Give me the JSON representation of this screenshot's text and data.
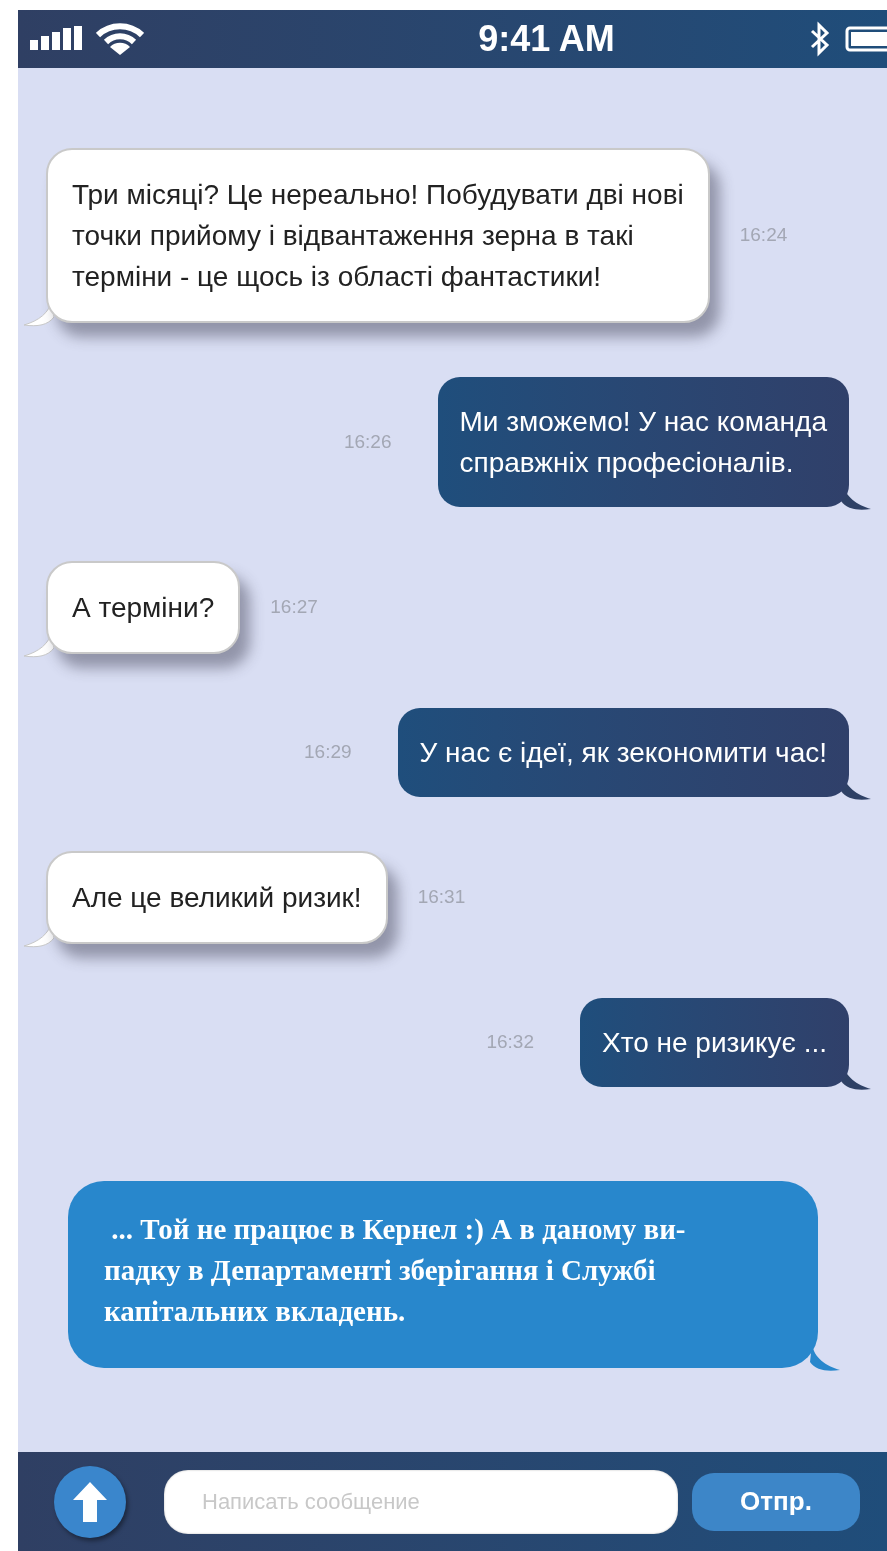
{
  "status_bar": {
    "time": "9:41 AM"
  },
  "messages": [
    {
      "kind": "incoming",
      "lines": [
        "Три місяці? Це нереально! Побудувати дві нові",
        "точки прийому і відвантаження зерна в такі",
        "терміни - це щось із області фантастики!"
      ],
      "time": "16:24"
    },
    {
      "kind": "outgoing",
      "lines": [
        "Ми зможемо! У нас команда",
        "справжніх професіоналів."
      ],
      "time": "16:26"
    },
    {
      "kind": "incoming",
      "lines": [
        "А терміни?"
      ],
      "time": "16:27"
    },
    {
      "kind": "outgoing",
      "lines": [
        "У нас є ідеї, як зекономити час!"
      ],
      "time": "16:29"
    },
    {
      "kind": "incoming",
      "lines": [
        "Але це великий ризик!"
      ],
      "time": "16:31"
    },
    {
      "kind": "outgoing",
      "lines": [
        "Хто не ризикує ..."
      ],
      "time": "16:32"
    },
    {
      "kind": "highlight",
      "lines": [
        " ... Той не працює в Кернел :) А в даному ви-",
        "падку в Департаменті зберігання і Службі",
        "капітальних вкладень."
      ]
    }
  ],
  "composer": {
    "placeholder": "Написать сообщение",
    "send_label": "Отпр."
  }
}
